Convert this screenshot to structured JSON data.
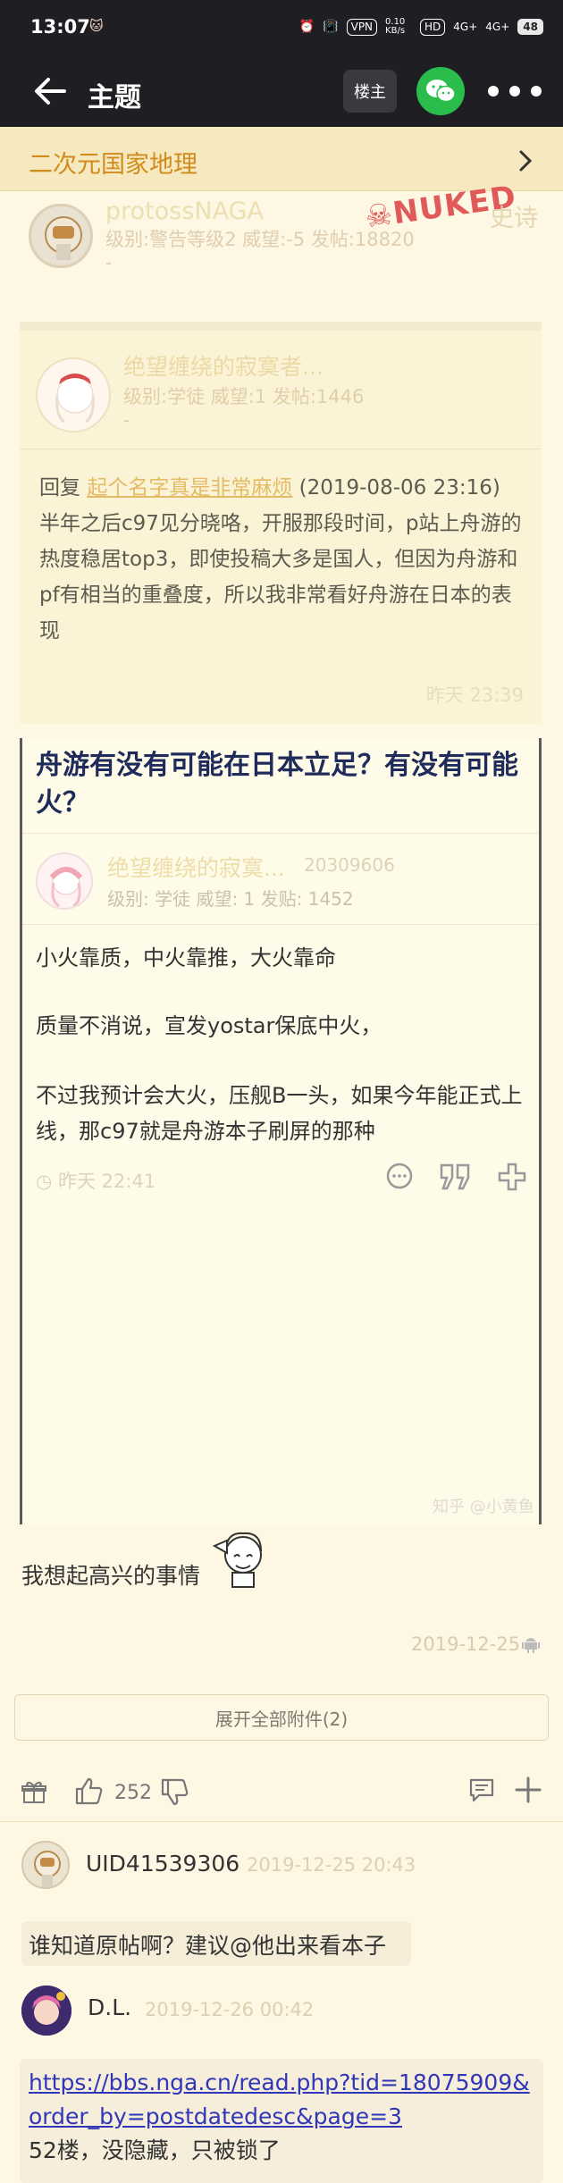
{
  "status_bar": {
    "time": "13:07",
    "net_speed": "0.10 KB/s",
    "hd": "HD",
    "vpn": "VPN",
    "signal1": "4G+",
    "signal2": "4G+",
    "battery": "48"
  },
  "app_bar": {
    "title": "主题",
    "owner_label": "楼主"
  },
  "forum": {
    "name": "二次元国家地理"
  },
  "author": {
    "name": "protossNAGA",
    "meta": "级别:警告等级2 威望:-5 发帖:18820",
    "dash": "-",
    "badge": "NUKED",
    "rank": "史诗"
  },
  "quote1": {
    "name": "绝望缠绕的寂寞者...",
    "meta": "级别:学徒    威望:1    发帖:1446",
    "dash": "-",
    "reply_prefix": "回复 ",
    "reply_link": "起个名字真是非常麻烦",
    "reply_suffix": " (2019-08-06 23:16)",
    "body": "半年之后c97见分晓咯，开服那段时间，p站上舟游的热度稳居top3，即使投稿大多是国人，但因为舟游和pf有相当的重叠度，所以我非常看好舟游在日本的表现",
    "time": "昨天 23:39"
  },
  "zhihu": {
    "title": "舟游有没有可能在日本立足？有没有可能火？",
    "name": "绝望缠绕的寂寞...",
    "uid": "20309606",
    "meta": "级别: 学徒    威望: 1    发贴: 1452",
    "p1": "小火靠质，中火靠推，大火靠命",
    "p2": "质量不消说，宣发yostar保底中火，",
    "p3": "不过我预计会大火，压舰B一头，如果今年能正式上线，那c97就是舟游本子刷屏的那种",
    "time": "昨天 22:41",
    "watermark": "知乎 @小黄鱼"
  },
  "post": {
    "text": "我想起高兴的事情",
    "time": "2019-12-25"
  },
  "expand_label": "展开全部附件(2)",
  "actions": {
    "like_count": "252"
  },
  "comments": [
    {
      "name": "UID41539306",
      "time": "2019-12-25 20:43",
      "text": "谁知道原帖啊？建议@他出来看本子"
    },
    {
      "name": "D.L.",
      "time": "2019-12-26 00:42",
      "link": "https://bbs.nga.cn/read.php?tid=18075909&order_by=postdatedesc&page=3",
      "text": "52楼，没隐藏，只被锁了"
    }
  ],
  "colors": {
    "accent": "#d08b1c",
    "background": "#fdf7e3",
    "topbar": "#1f1f23",
    "wechat": "#2bbd4c",
    "link": "#2f37b8"
  }
}
